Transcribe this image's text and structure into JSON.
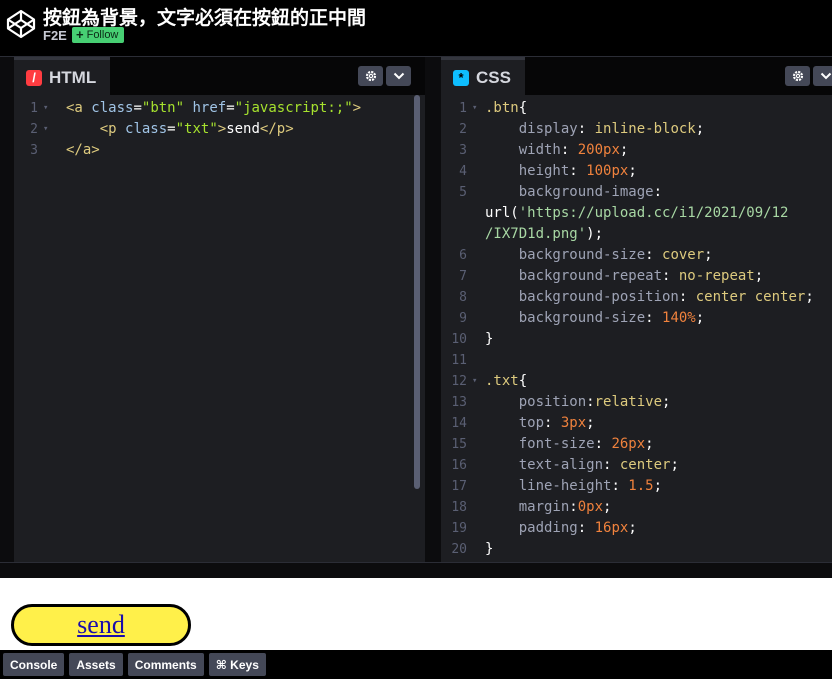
{
  "header": {
    "title": "按鈕為背景，文字必須在按鈕的正中間",
    "author": "F2E",
    "follow_label": "Follow",
    "follow_icon": "plus-icon"
  },
  "editors": {
    "html": {
      "tab_label": "HTML",
      "tab_icon": "html-slash-icon",
      "lines": [
        {
          "n": "1",
          "fold": "▾",
          "parts": [
            [
              "t-tag",
              "<a "
            ],
            [
              "t-attr",
              "class"
            ],
            [
              "t-plain",
              "="
            ],
            [
              "t-str",
              "\"btn\""
            ],
            [
              "t-plain",
              " "
            ],
            [
              "t-attr",
              "href"
            ],
            [
              "t-plain",
              "="
            ],
            [
              "t-str",
              "\"javascript:;\""
            ],
            [
              "t-tag",
              ">"
            ]
          ]
        },
        {
          "n": "2",
          "fold": "▾",
          "parts": [
            [
              "t-plain",
              "    "
            ],
            [
              "t-tag",
              "<p "
            ],
            [
              "t-attr",
              "class"
            ],
            [
              "t-plain",
              "="
            ],
            [
              "t-str",
              "\"txt\""
            ],
            [
              "t-tag",
              ">"
            ],
            [
              "t-plain",
              "send"
            ],
            [
              "t-tag",
              "</p>"
            ]
          ]
        },
        {
          "n": "3",
          "fold": "",
          "parts": [
            [
              "t-tag",
              "</a>"
            ]
          ]
        }
      ]
    },
    "css": {
      "tab_label": "CSS",
      "tab_icon": "css-asterisk-icon",
      "lines": [
        {
          "n": "1",
          "fold": "▾",
          "parts": [
            [
              "t-sel",
              ".btn"
            ],
            [
              "t-plain",
              "{"
            ]
          ]
        },
        {
          "n": "2",
          "fold": "",
          "parts": [
            [
              "t-plain",
              "    "
            ],
            [
              "t-prop",
              "display"
            ],
            [
              "t-plain",
              ": "
            ],
            [
              "t-val",
              "inline-block"
            ],
            [
              "t-plain",
              ";"
            ]
          ]
        },
        {
          "n": "3",
          "fold": "",
          "parts": [
            [
              "t-plain",
              "    "
            ],
            [
              "t-prop",
              "width"
            ],
            [
              "t-plain",
              ": "
            ],
            [
              "t-num",
              "200px"
            ],
            [
              "t-plain",
              ";"
            ]
          ]
        },
        {
          "n": "4",
          "fold": "",
          "parts": [
            [
              "t-plain",
              "    "
            ],
            [
              "t-prop",
              "height"
            ],
            [
              "t-plain",
              ": "
            ],
            [
              "t-num",
              "100px"
            ],
            [
              "t-plain",
              ";"
            ]
          ]
        },
        {
          "n": "5",
          "fold": "",
          "parts": [
            [
              "t-plain",
              "    "
            ],
            [
              "t-prop",
              "background-image"
            ],
            [
              "t-plain",
              ":"
            ]
          ]
        },
        {
          "n": "",
          "fold": "",
          "parts": [
            [
              "t-plain",
              "url("
            ],
            [
              "t-str2",
              "'https://upload.cc/i1/2021/09/12"
            ]
          ]
        },
        {
          "n": "",
          "fold": "",
          "parts": [
            [
              "t-str2",
              "/IX7D1d.png'"
            ],
            [
              "t-plain",
              ");"
            ]
          ]
        },
        {
          "n": "6",
          "fold": "",
          "parts": [
            [
              "t-plain",
              "    "
            ],
            [
              "t-prop",
              "background-size"
            ],
            [
              "t-plain",
              ": "
            ],
            [
              "t-val",
              "cover"
            ],
            [
              "t-plain",
              ";"
            ]
          ]
        },
        {
          "n": "7",
          "fold": "",
          "parts": [
            [
              "t-plain",
              "    "
            ],
            [
              "t-prop",
              "background-repeat"
            ],
            [
              "t-plain",
              ": "
            ],
            [
              "t-val",
              "no-repeat"
            ],
            [
              "t-plain",
              ";"
            ]
          ]
        },
        {
          "n": "8",
          "fold": "",
          "parts": [
            [
              "t-plain",
              "    "
            ],
            [
              "t-prop",
              "background-position"
            ],
            [
              "t-plain",
              ": "
            ],
            [
              "t-val",
              "center center"
            ],
            [
              "t-plain",
              ";"
            ]
          ]
        },
        {
          "n": "9",
          "fold": "",
          "parts": [
            [
              "t-plain",
              "    "
            ],
            [
              "t-prop",
              "background-size"
            ],
            [
              "t-plain",
              ": "
            ],
            [
              "t-num",
              "140%"
            ],
            [
              "t-plain",
              ";"
            ]
          ]
        },
        {
          "n": "10",
          "fold": "",
          "parts": [
            [
              "t-plain",
              "}"
            ]
          ]
        },
        {
          "n": "11",
          "fold": "",
          "parts": []
        },
        {
          "n": "12",
          "fold": "▾",
          "parts": [
            [
              "t-sel",
              ".txt"
            ],
            [
              "t-plain",
              "{"
            ]
          ]
        },
        {
          "n": "13",
          "fold": "",
          "parts": [
            [
              "t-plain",
              "    "
            ],
            [
              "t-prop",
              "position"
            ],
            [
              "t-plain",
              ":"
            ],
            [
              "t-val",
              "relative"
            ],
            [
              "t-plain",
              ";"
            ]
          ]
        },
        {
          "n": "14",
          "fold": "",
          "parts": [
            [
              "t-plain",
              "    "
            ],
            [
              "t-prop",
              "top"
            ],
            [
              "t-plain",
              ": "
            ],
            [
              "t-num",
              "3px"
            ],
            [
              "t-plain",
              ";"
            ]
          ]
        },
        {
          "n": "15",
          "fold": "",
          "parts": [
            [
              "t-plain",
              "    "
            ],
            [
              "t-prop",
              "font-size"
            ],
            [
              "t-plain",
              ": "
            ],
            [
              "t-num",
              "26px"
            ],
            [
              "t-plain",
              ";"
            ]
          ]
        },
        {
          "n": "16",
          "fold": "",
          "parts": [
            [
              "t-plain",
              "    "
            ],
            [
              "t-prop",
              "text-align"
            ],
            [
              "t-plain",
              ": "
            ],
            [
              "t-val",
              "center"
            ],
            [
              "t-plain",
              ";"
            ]
          ]
        },
        {
          "n": "17",
          "fold": "",
          "parts": [
            [
              "t-plain",
              "    "
            ],
            [
              "t-prop",
              "line-height"
            ],
            [
              "t-plain",
              ": "
            ],
            [
              "t-num",
              "1.5"
            ],
            [
              "t-plain",
              ";"
            ]
          ]
        },
        {
          "n": "18",
          "fold": "",
          "parts": [
            [
              "t-plain",
              "    "
            ],
            [
              "t-prop",
              "margin"
            ],
            [
              "t-plain",
              ":"
            ],
            [
              "t-num",
              "0px"
            ],
            [
              "t-plain",
              ";"
            ]
          ]
        },
        {
          "n": "19",
          "fold": "",
          "parts": [
            [
              "t-plain",
              "    "
            ],
            [
              "t-prop",
              "padding"
            ],
            [
              "t-plain",
              ": "
            ],
            [
              "t-num",
              "16px"
            ],
            [
              "t-plain",
              ";"
            ]
          ]
        },
        {
          "n": "20",
          "fold": "",
          "parts": [
            [
              "t-plain",
              "}"
            ]
          ]
        }
      ]
    }
  },
  "preview": {
    "button_text": "send"
  },
  "bottom_bar": {
    "buttons": [
      "Console",
      "Assets",
      "Comments",
      "⌘ Keys"
    ]
  },
  "colors": {
    "accent_green": "#47cf73",
    "preview_button_fill": "#fff04a"
  }
}
